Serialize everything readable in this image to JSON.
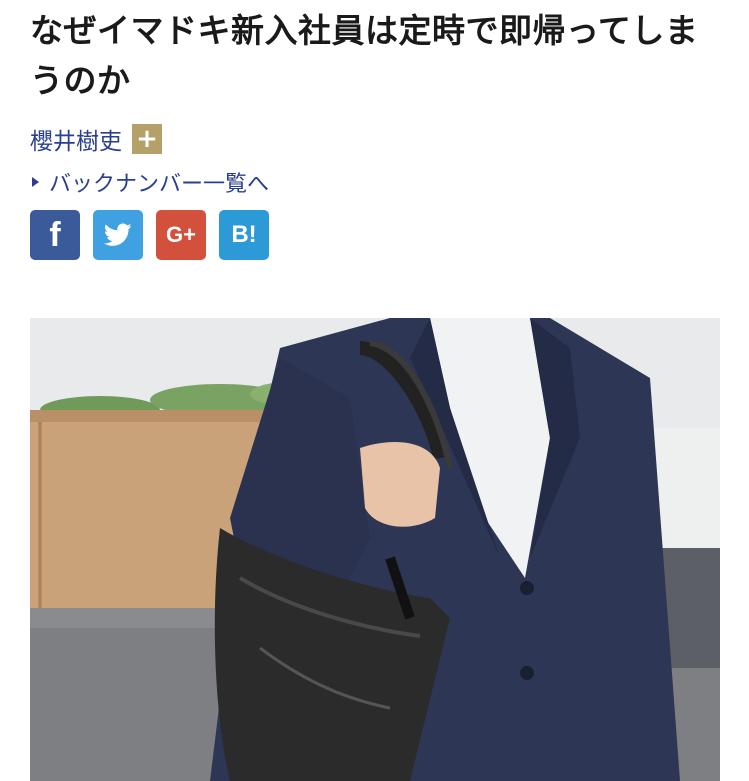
{
  "article": {
    "title": "なぜイマドキ新入社員は定時で即帰ってしまうのか",
    "author": "櫻井樹吏",
    "follow_symbol": "+",
    "backnumber_label": "バックナンバー一覧へ"
  },
  "share": {
    "facebook_glyph": "f",
    "googleplus_glyph": "G+",
    "hatena_glyph": "B!"
  },
  "colors": {
    "link": "#2a3f8f",
    "follow": "#b5a06a",
    "facebook": "#3b5a9a",
    "twitter": "#3fa1e2",
    "googleplus": "#d3503d",
    "hatena": "#2d9ad8"
  },
  "photo": {
    "icon": "article-photo"
  }
}
